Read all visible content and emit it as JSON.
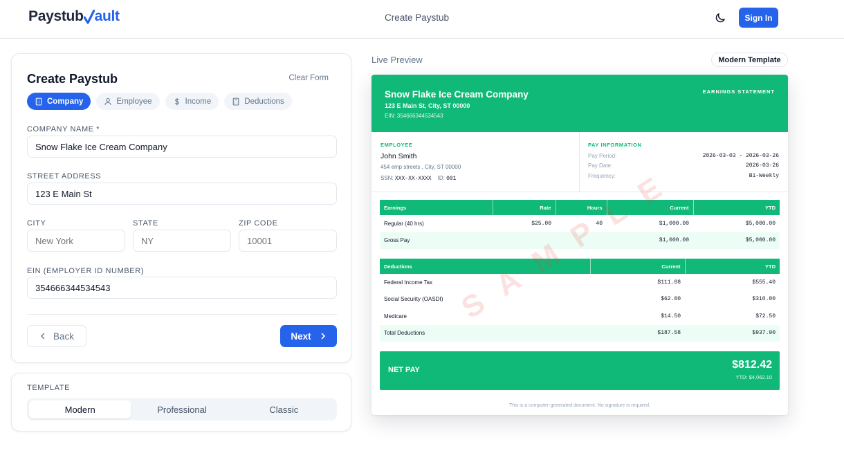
{
  "header": {
    "logo_text_a": "Paystub",
    "logo_text_b": "ault",
    "nav_title": "Create Paystub",
    "theme_icon": "moon-icon",
    "signin_label": "Sign In"
  },
  "form": {
    "title": "Create Paystub",
    "clear_label": "Clear Form",
    "tabs": [
      {
        "label": "Company",
        "icon": "building-icon",
        "active": true
      },
      {
        "label": "Employee",
        "icon": "user-icon",
        "active": false
      },
      {
        "label": "Income",
        "icon": "dollar-icon",
        "active": false
      },
      {
        "label": "Deductions",
        "icon": "calculator-icon",
        "active": false
      }
    ],
    "company_name_label": "COMPANY NAME *",
    "company_name_value": "Snow Flake Ice Cream Company",
    "street_label": "STREET ADDRESS",
    "street_value": "123 E Main St",
    "city_label": "CITY",
    "city_placeholder": "New York",
    "state_label": "STATE",
    "state_placeholder": "NY",
    "zip_label": "ZIP CODE",
    "zip_placeholder": "10001",
    "ein_label": "EIN (EMPLOYER ID NUMBER)",
    "ein_value": "354666344534543",
    "back_label": "Back",
    "next_label": "Next"
  },
  "template_picker": {
    "label": "TEMPLATE",
    "options": [
      "Modern",
      "Professional",
      "Classic"
    ],
    "selected": "Modern"
  },
  "preview": {
    "label": "Live Preview",
    "template_badge": "Modern Template",
    "watermark": "SAMPLE",
    "company": {
      "name": "Snow Flake Ice Cream Company",
      "address": "123 E Main St, City, ST 00000",
      "ein": "EIN: 354666344534543"
    },
    "statement_title": "EARNINGS STATEMENT",
    "employee": {
      "section_label": "EMPLOYEE",
      "name": "John Smith",
      "address": "454 emp streets , City, ST 00000",
      "ssn_label": "SSN:",
      "ssn": "XXX-XX-XXXX",
      "id_label": "ID:",
      "id": "001"
    },
    "pay_info": {
      "section_label": "PAY INFORMATION",
      "rows": [
        {
          "k": "Pay Period:",
          "v": "2026-03-03 - 2026-03-26"
        },
        {
          "k": "Pay Date:",
          "v": "2026-03-26"
        },
        {
          "k": "Frequency:",
          "v": "Bi-Weekly"
        }
      ]
    },
    "earnings": {
      "headers": [
        "Earnings",
        "Rate",
        "Hours",
        "Current",
        "YTD"
      ],
      "rows": [
        [
          "Regular (40 hrs)",
          "$25.00",
          "40",
          "$1,000.00",
          "$5,000.00"
        ]
      ],
      "total": [
        "Gross Pay",
        "",
        "",
        "$1,000.00",
        "$5,000.00"
      ]
    },
    "deductions": {
      "headers": [
        "Deductions",
        "Current",
        "YTD"
      ],
      "rows": [
        [
          "Federal Income Tax",
          "$111.08",
          "$555.40"
        ],
        [
          "Social Security (OASDI)",
          "$62.00",
          "$310.00"
        ],
        [
          "Medicare",
          "$14.50",
          "$72.50"
        ]
      ],
      "total": [
        "Total Deductions",
        "$187.58",
        "$937.90"
      ]
    },
    "net_pay": {
      "label": "NET PAY",
      "amount": "$812.42",
      "ytd": "YTD: $4,062.10"
    },
    "footer": "This is a computer-generated document. No signature is required."
  },
  "colors": {
    "primary": "#2563eb",
    "accent_green": "#10b978"
  }
}
